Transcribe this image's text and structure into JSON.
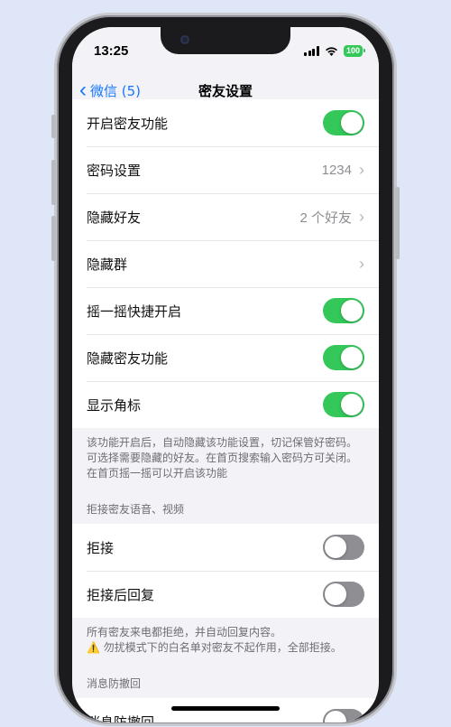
{
  "status_bar": {
    "time": "13:25",
    "battery": "100"
  },
  "nav": {
    "back_label": "微信 (5)",
    "title": "密友设置"
  },
  "group1": {
    "rows": [
      {
        "label": "开启密友功能",
        "toggle": "on"
      },
      {
        "label": "密码设置",
        "value": "1234",
        "chevron": true
      },
      {
        "label": "隐藏好友",
        "value": "2 个好友",
        "chevron": true
      },
      {
        "label": "隐藏群",
        "chevron": true
      },
      {
        "label": "摇一摇快捷开启",
        "toggle": "on"
      },
      {
        "label": "隐藏密友功能",
        "toggle": "on"
      },
      {
        "label": "显示角标",
        "toggle": "on"
      }
    ],
    "footnote": "该功能开启后，自动隐藏该功能设置，切记保管好密码。可选择需要隐藏的好友。在首页搜索输入密码方可关闭。在首页摇一摇可以开启该功能"
  },
  "group2": {
    "header": "拒接密友语音、视频",
    "rows": [
      {
        "label": "拒接",
        "toggle": "off"
      },
      {
        "label": "拒接后回复",
        "toggle": "off"
      }
    ],
    "footnote_line1": "所有密友来电都拒绝，并自动回复内容。",
    "footnote_line2": "⚠️ 勿扰模式下的白名单对密友不起作用，全部拒接。"
  },
  "group3": {
    "header": "消息防撤回",
    "rows": [
      {
        "label": "消息防撤回",
        "toggle": "off"
      }
    ]
  },
  "colors": {
    "accent_green": "#34c759",
    "link_blue": "#1677ff",
    "background": "#dfe6f7"
  }
}
